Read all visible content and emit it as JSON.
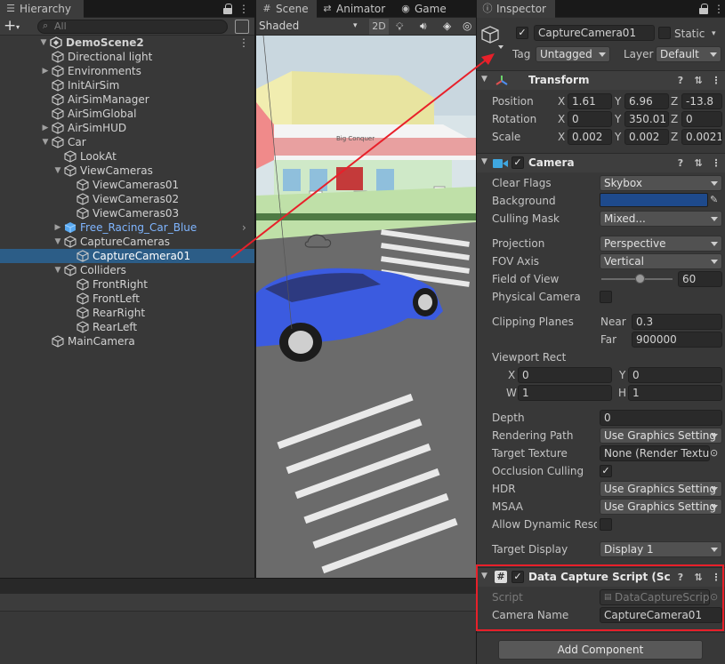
{
  "hierarchy": {
    "tab_label": "Hierarchy",
    "add_label": "+",
    "search_placeholder": "All",
    "items": [
      {
        "label": "DemoScene2"
      },
      {
        "label": "Directional light"
      },
      {
        "label": "Environments"
      },
      {
        "label": "InitAirSim"
      },
      {
        "label": "AirSimManager"
      },
      {
        "label": "AirSimGlobal"
      },
      {
        "label": "AirSimHUD"
      },
      {
        "label": "Car"
      },
      {
        "label": "LookAt"
      },
      {
        "label": "ViewCameras"
      },
      {
        "label": "ViewCameras01"
      },
      {
        "label": "ViewCameras02"
      },
      {
        "label": "ViewCameras03"
      },
      {
        "label": "Free_Racing_Car_Blue"
      },
      {
        "label": "CaptureCameras"
      },
      {
        "label": "CaptureCamera01"
      },
      {
        "label": "Colliders"
      },
      {
        "label": "FrontRight"
      },
      {
        "label": "FrontLeft"
      },
      {
        "label": "RearRight"
      },
      {
        "label": "RearLeft"
      },
      {
        "label": "MainCamera"
      }
    ]
  },
  "scene": {
    "tabs": [
      {
        "label": "Scene"
      },
      {
        "label": "Animator"
      },
      {
        "label": "Game"
      }
    ],
    "shading": "Shaded",
    "mode_2d": "2D",
    "billboard_text": "Big Conquer"
  },
  "inspector": {
    "tab_label": "Inspector",
    "object_name": "CaptureCamera01",
    "static_label": "Static",
    "tag_label": "Tag",
    "tag_value": "Untagged",
    "layer_label": "Layer",
    "layer_value": "Default",
    "transform": {
      "title": "Transform",
      "position_label": "Position",
      "rotation_label": "Rotation",
      "scale_label": "Scale",
      "axes": [
        "X",
        "Y",
        "Z"
      ],
      "position": [
        "1.61",
        "6.96",
        "-13.8"
      ],
      "rotation": [
        "0",
        "350.01",
        "0"
      ],
      "scale": [
        "0.002",
        "0.002",
        "0.0021"
      ]
    },
    "camera": {
      "title": "Camera",
      "clear_flags_label": "Clear Flags",
      "clear_flags": "Skybox",
      "background_label": "Background",
      "background_color": "#1e4a8c",
      "culling_mask_label": "Culling Mask",
      "culling_mask": "Mixed...",
      "projection_label": "Projection",
      "projection": "Perspective",
      "fov_axis_label": "FOV Axis",
      "fov_axis": "Vertical",
      "fov_label": "Field of View",
      "fov": "60",
      "fov_fraction": 0.54,
      "physical_label": "Physical Camera",
      "clipping_label": "Clipping Planes",
      "near_label": "Near",
      "near": "0.3",
      "far_label": "Far",
      "far": "900000",
      "viewport_label": "Viewport Rect",
      "vx_label": "X",
      "vx": "0",
      "vy_label": "Y",
      "vy": "0",
      "vw_label": "W",
      "vw": "1",
      "vh_label": "H",
      "vh": "1",
      "depth_label": "Depth",
      "depth": "0",
      "rendering_path_label": "Rendering Path",
      "rendering_path": "Use Graphics Setting",
      "target_texture_label": "Target Texture",
      "target_texture": "None (Render Textur",
      "occlusion_label": "Occlusion Culling",
      "hdr_label": "HDR",
      "hdr": "Use Graphics Setting",
      "msaa_label": "MSAA",
      "msaa": "Use Graphics Setting",
      "dynres_label": "Allow Dynamic Resol",
      "target_display_label": "Target Display",
      "target_display": "Display 1"
    },
    "data_capture": {
      "title": "Data Capture Script (Scrip",
      "script_label": "Script",
      "script": "DataCaptureScript",
      "camera_name_label": "Camera Name",
      "camera_name": "CaptureCamera01"
    },
    "add_component": "Add Component"
  },
  "colors": {
    "selection": "#2c5d87",
    "highlight_red": "#e8202a",
    "prefab_blue": "#7fb5ff"
  }
}
